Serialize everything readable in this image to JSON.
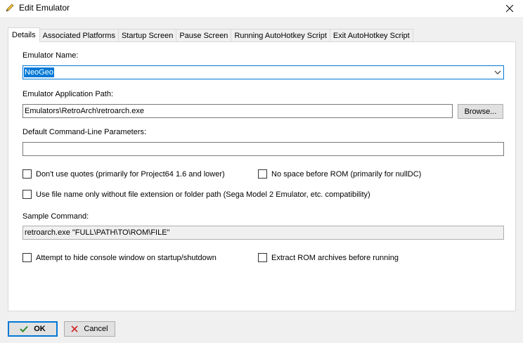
{
  "window": {
    "title": "Edit Emulator"
  },
  "tabs": [
    {
      "label": "Details"
    },
    {
      "label": "Associated Platforms"
    },
    {
      "label": "Startup Screen"
    },
    {
      "label": "Pause Screen"
    },
    {
      "label": "Running AutoHotkey Script"
    },
    {
      "label": "Exit AutoHotkey Script"
    }
  ],
  "details": {
    "emulator_name_label": "Emulator Name:",
    "emulator_name_value": "NeoGeo",
    "app_path_label": "Emulator Application Path:",
    "app_path_value": "Emulators\\RetroArch\\retroarch.exe",
    "browse_label": "Browse...",
    "params_label": "Default Command-Line Parameters:",
    "params_value": "",
    "options": {
      "no_quotes": {
        "label": "Don't use quotes (primarily for Project64 1.6 and lower)",
        "checked": false
      },
      "no_space": {
        "label": "No space before ROM (primarily for nullDC)",
        "checked": false
      },
      "file_name_only": {
        "label": "Use file name only without file extension or folder path (Sega Model 2 Emulator, etc. compatibility)",
        "checked": false
      },
      "hide_console": {
        "label": "Attempt to hide console window on startup/shutdown",
        "checked": false
      },
      "extract_rom": {
        "label": "Extract ROM archives before running",
        "checked": false
      }
    },
    "sample_label": "Sample Command:",
    "sample_value": "retroarch.exe \"FULL\\PATH\\TO\\ROM\\FILE\""
  },
  "footer": {
    "ok_label": "OK",
    "cancel_label": "Cancel"
  },
  "icons": {
    "title": "pencil-icon",
    "close": "close-icon",
    "dropdown": "chevron-down-icon",
    "ok": "checkmark-icon",
    "cancel": "red-x-icon"
  },
  "colors": {
    "accent": "#0078d7",
    "ok_check": "#2e8b2e",
    "cancel_x": "#d32f2f"
  }
}
